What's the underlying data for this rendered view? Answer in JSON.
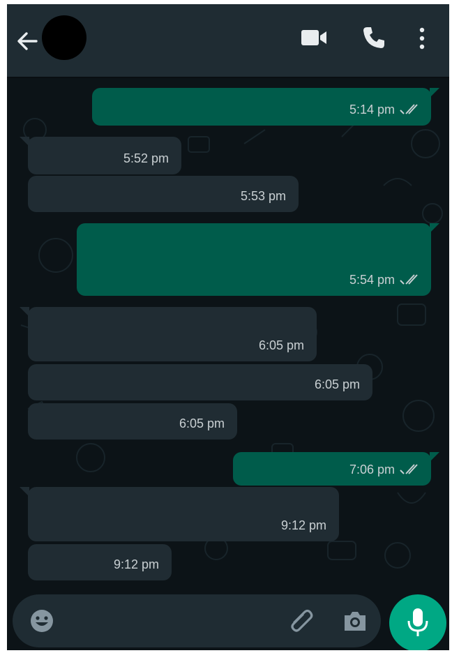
{
  "header": {
    "back": "arrow-left-icon",
    "video": "video-camera-icon",
    "call": "phone-icon",
    "menu": "more-vertical-icon"
  },
  "messages": [
    {
      "dir": "out",
      "time": "5:14 pm"
    },
    {
      "dir": "in",
      "time": "5:52 pm"
    },
    {
      "dir": "in",
      "time": "5:53 pm"
    },
    {
      "dir": "out",
      "time": "5:54 pm"
    },
    {
      "dir": "in",
      "time": "6:05 pm"
    },
    {
      "dir": "in",
      "time": "6:05 pm"
    },
    {
      "dir": "in",
      "time": "6:05 pm"
    },
    {
      "dir": "out",
      "time": "7:06 pm"
    },
    {
      "dir": "in",
      "time": "9:12 pm"
    },
    {
      "dir": "in",
      "time": "9:12 pm"
    }
  ],
  "composer": {
    "emoji": "emoji-icon",
    "attach": "paperclip-icon",
    "camera": "camera-icon",
    "mic": "microphone-icon"
  },
  "colors": {
    "background": "#0c1317",
    "header": "#1f2c33",
    "incoming": "#202c33",
    "outgoing": "#005c4b",
    "accent": "#00a884"
  }
}
